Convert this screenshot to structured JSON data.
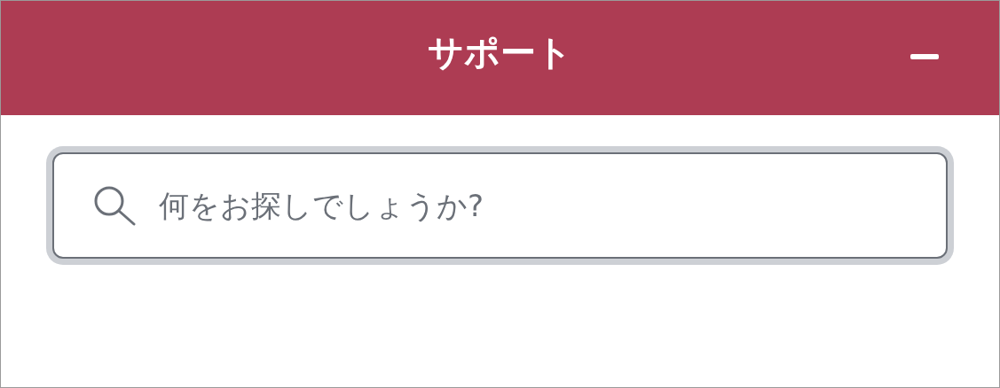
{
  "header": {
    "title": "サポート"
  },
  "search": {
    "placeholder": "何をお探しでしょうか?",
    "focused": true
  }
}
